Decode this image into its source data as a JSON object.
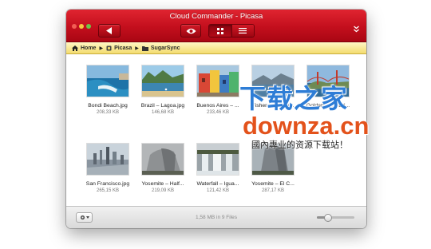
{
  "window": {
    "title": "Cloud Commander - Picasa",
    "colors": {
      "titlebar": "#c30f1d",
      "pathbar": "#f3dc6e",
      "status": "#d9d9d9"
    }
  },
  "toolbar": {
    "back_icon": "back-arrow-icon",
    "preview_icon": "eye-icon",
    "grid_icon": "grid-view-icon",
    "list_icon": "list-view-icon",
    "more_icon": "chevrons-down-icon"
  },
  "path": {
    "home": "Home",
    "picasa": "Picasa",
    "sugarsync": "SugarSync"
  },
  "files": [
    {
      "name": "Bondi Beach.jpg",
      "size": "208,33 KB",
      "thumb": "beach"
    },
    {
      "name": "Brazil – Lagoa.jpg",
      "size": "146,68 KB",
      "thumb": "lagoon"
    },
    {
      "name": "Buenos Aires – ...",
      "size": "233,46 KB",
      "thumb": "city-colorful"
    },
    {
      "name": "Fishermen near...",
      "size": "",
      "thumb": "coast"
    },
    {
      "name": "Golden Gate Bri...",
      "size": "",
      "thumb": "bridge"
    },
    {
      "name": "San Francisco.jpg",
      "size": "265,15 KB",
      "thumb": "skyline"
    },
    {
      "name": "Yosemite – Half...",
      "size": "219,09 KB",
      "thumb": "rock"
    },
    {
      "name": "Waterfall – Igua...",
      "size": "121,42 KB",
      "thumb": "waterfall"
    },
    {
      "name": "Yosemite – El C...",
      "size": "287,17 KB",
      "thumb": "cliff"
    }
  ],
  "status": {
    "text": "1,58 MB in 9 Files",
    "zoom_fraction": 0.3
  },
  "watermark": {
    "line1": "下载之家",
    "line2": "downza.cn",
    "line3": "國內專业的资源下载站！"
  }
}
